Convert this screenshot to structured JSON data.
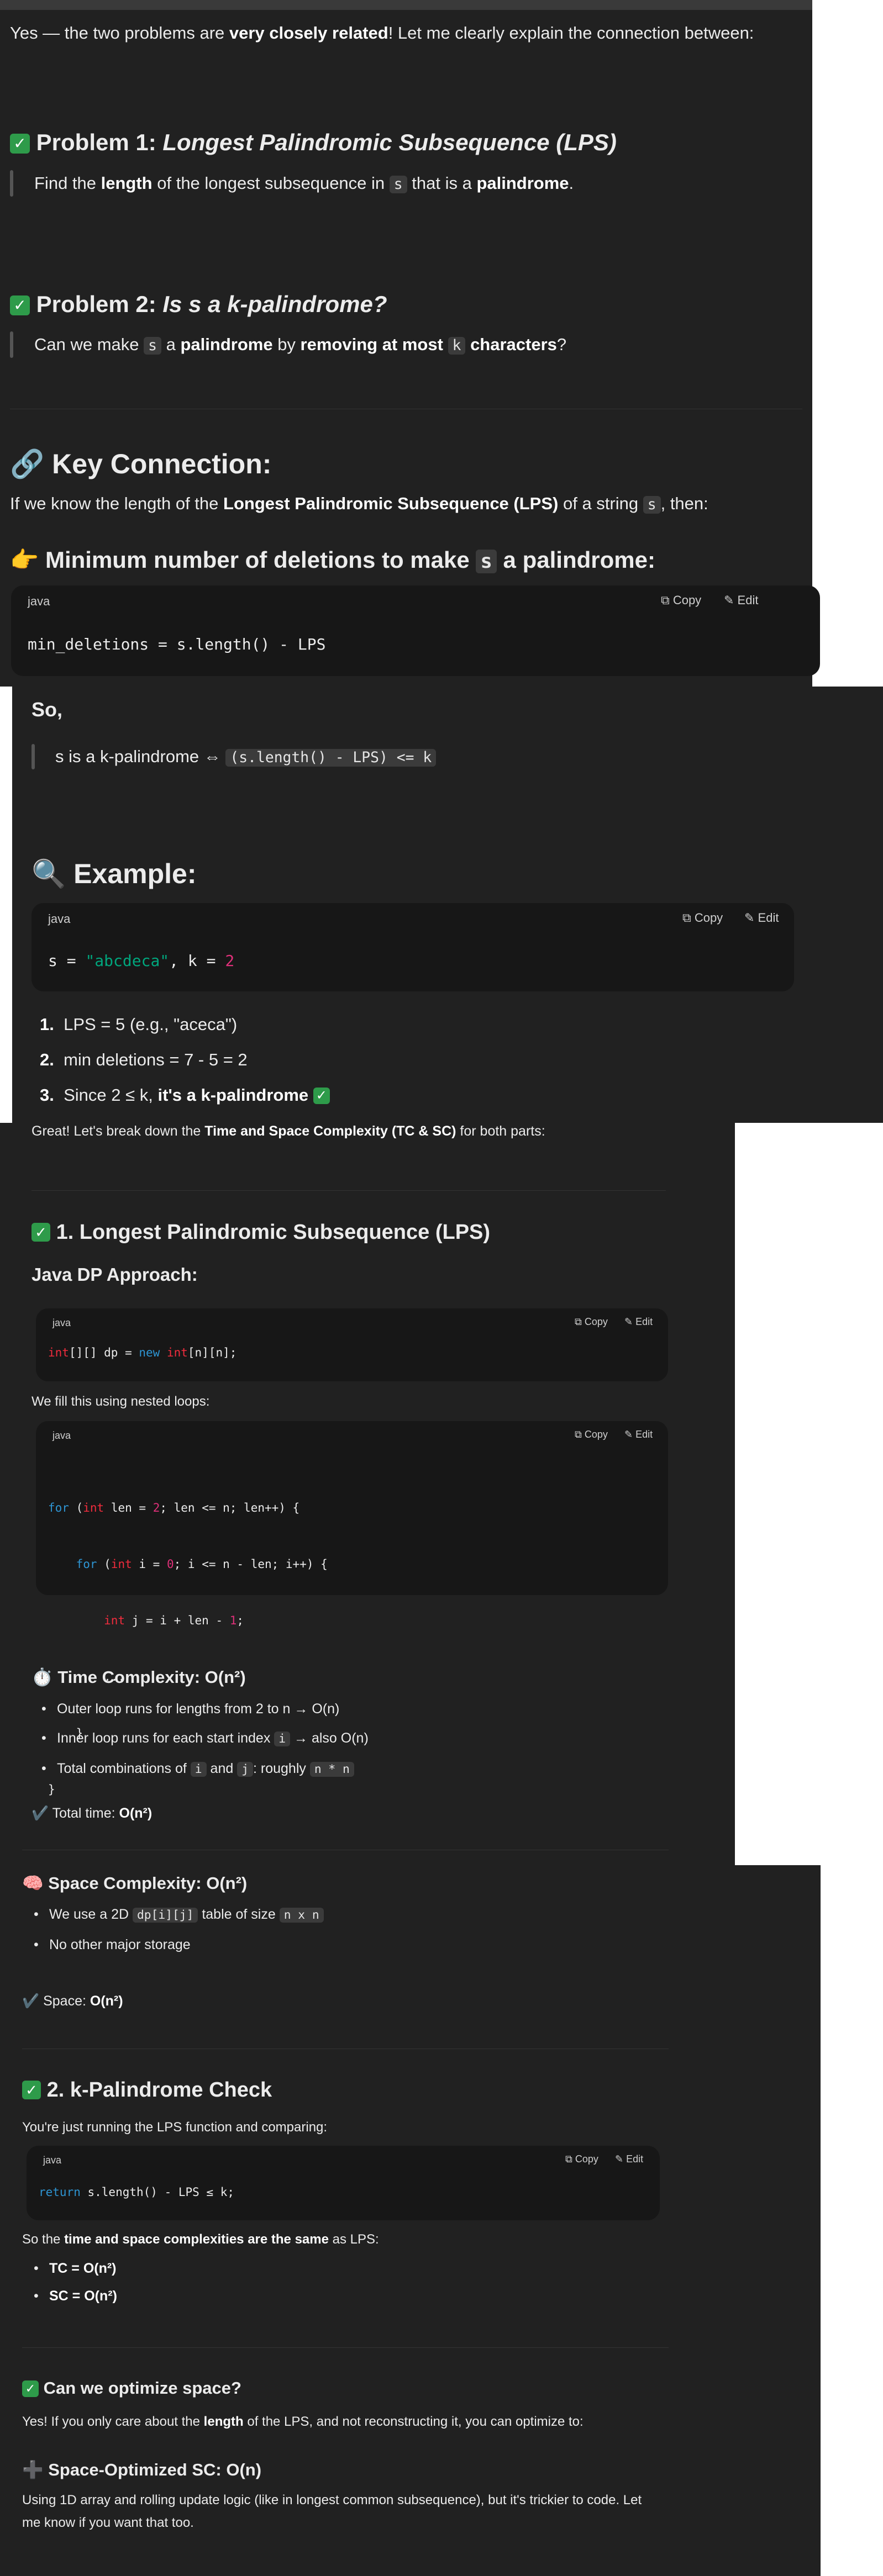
{
  "intro": {
    "text_a": "Yes — the two problems are ",
    "bold": "very closely related",
    "text_b": "! Let me clearly explain the connection between:"
  },
  "problem1": {
    "label": "Problem 1: ",
    "title": "Longest Palindromic Subsequence (LPS)",
    "q_a": "Find the ",
    "q_b": "length",
    "q_c": " of the longest subsequence in ",
    "q_code": "s",
    "q_d": " that is a ",
    "q_e": "palindrome",
    "q_f": "."
  },
  "problem2": {
    "label": "Problem 2: ",
    "title": "Is s a k-palindrome?",
    "q_a": "Can we make ",
    "q_code1": "s",
    "q_b": " a ",
    "q_c": "palindrome",
    "q_d": " by ",
    "q_e": "removing at most",
    "q_code2": "k",
    "q_f": "characters",
    "q_g": "?"
  },
  "connection": {
    "icon": "🔗",
    "title": "Key Connection:",
    "text_a": "If we know the length of the ",
    "bold": "Longest Palindromic Subsequence (LPS)",
    "text_b": " of a string ",
    "code": "s",
    "text_c": ", then:"
  },
  "min_del": {
    "icon": "👉",
    "title_a": "Minimum number of deletions to make ",
    "code": "s",
    "title_b": " a palindrome:"
  },
  "code_actions": {
    "copy": "Copy",
    "edit": "Edit",
    "lang": "java"
  },
  "code1": {
    "line": "min_deletions = s.length() - LPS"
  },
  "so": {
    "title": "So,",
    "text": "s is a k-palindrome ⇔ ",
    "code": "(s.length() - LPS) <= k"
  },
  "example": {
    "icon": "🔍",
    "title": "Example:",
    "c_a": "s = ",
    "c_str": "\"abcdeca\"",
    "c_b": ", k = ",
    "c_num": "2",
    "items": [
      {
        "n": "1.",
        "text": "LPS = 5 (e.g., \"aceca\")"
      },
      {
        "n": "2.",
        "text": "min deletions = 7 - 5 = 2"
      },
      {
        "n": "3.",
        "text": "Since 2 ≤ k, ",
        "bold": "it's a k-palindrome"
      }
    ]
  },
  "tc_intro": {
    "text_a": "Great! Let's break down the ",
    "bold": "Time and Space Complexity (TC & SC)",
    "text_b": " for both parts:"
  },
  "section1": {
    "title": "1. Longest Palindromic Subsequence (LPS)",
    "sub": "Java DP Approach:",
    "dp_ty": "int",
    "dp_a": "[][] dp = ",
    "dp_kw": "new",
    "dp_sp": " ",
    "dp_ty2": "int",
    "dp_b": "[n][n];",
    "fill": "We fill this using nested loops:",
    "loop": {
      "l1_kw": "for",
      "l1_a": " (",
      "l1_ty": "int",
      "l1_b": " len = ",
      "l1_num": "2",
      "l1_c": "; len <= n; len++) {",
      "l2_kw": "for",
      "l2_a": " (",
      "l2_ty": "int",
      "l2_b": " i = ",
      "l2_num": "0",
      "l2_c": "; i <= n - len; i++) {",
      "l3_ty": "int",
      "l3_b": " j = i + len - ",
      "l3_num": "1",
      "l3_c": ";",
      "l4": "...",
      "l5": "}",
      "l6": "}"
    }
  },
  "time": {
    "icon": "⏱️",
    "title": "Time Complexity: O(n²)",
    "b1": "Outer loop runs for lengths from 2 to n → O(n)",
    "b2_a": "Inner loop runs for each start index ",
    "b2_code": "i",
    "b2_b": " → also O(n)",
    "b3_a": "Total combinations of ",
    "b3_c1": "i",
    "b3_b": " and ",
    "b3_c2": "j",
    "b3_c": ": roughly ",
    "b3_c3": "n * n",
    "total_icon": "✔️",
    "total_a": "Total time: ",
    "total_b": "O(n²)"
  },
  "space": {
    "icon": "🧠",
    "title": "Space Complexity: O(n²)",
    "b1_a": "We use a 2D ",
    "b1_c1": "dp[i][j]",
    "b1_b": " table of size ",
    "b1_c2": "n x n",
    "b2": "No other major storage",
    "total_icon": "✔️",
    "total_a": "Space: ",
    "total_b": "O(n²)"
  },
  "section2": {
    "title": "2. k-Palindrome Check",
    "intro": "You're just running the LPS function and comparing:",
    "c_kw": "return",
    "c_rest": " s.length() - LPS ≤ k;",
    "so_a": "So the ",
    "so_b": "time and space complexities are the same",
    "so_c": " as LPS:",
    "tc": "TC = O(n²)",
    "sc": "SC = O(n²)"
  },
  "optimize": {
    "title": "Can we optimize space?",
    "text_a": "Yes! If you only care about the ",
    "text_b": "length",
    "text_c": " of the LPS, and not reconstructing it, you can optimize to:",
    "sub_icon": "➕",
    "sub_title": "Space-Optimized SC: O(n)",
    "p1": "Using 1D array and rolling update logic (like in longest common subsequence), but it's trickier to code. Let",
    "p2": "me know if you want that too."
  },
  "check_glyph": "✓",
  "colors": {
    "bg": "#212121",
    "code_bg": "#171717",
    "check": "#2e9b4a",
    "keyword": "#2e95d3",
    "type": "#f22c3d",
    "number": "#df3079",
    "string": "#00a67d"
  }
}
